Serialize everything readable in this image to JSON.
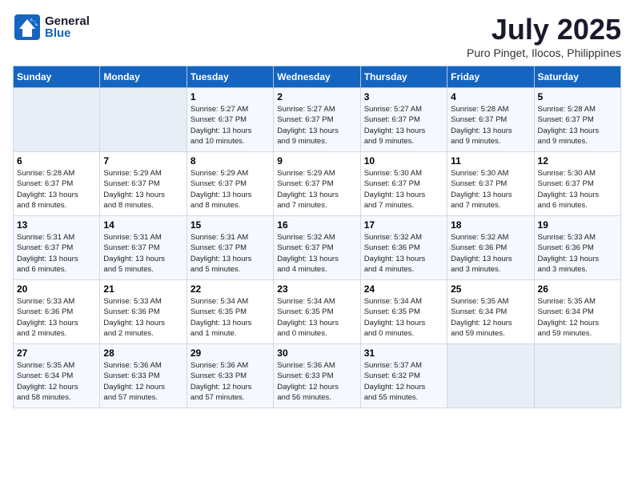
{
  "logo": {
    "general": "General",
    "blue": "Blue"
  },
  "title": "July 2025",
  "location": "Puro Pinget, Ilocos, Philippines",
  "headers": [
    "Sunday",
    "Monday",
    "Tuesday",
    "Wednesday",
    "Thursday",
    "Friday",
    "Saturday"
  ],
  "weeks": [
    [
      {
        "day": "",
        "info": ""
      },
      {
        "day": "",
        "info": ""
      },
      {
        "day": "1",
        "info": "Sunrise: 5:27 AM\nSunset: 6:37 PM\nDaylight: 13 hours\nand 10 minutes."
      },
      {
        "day": "2",
        "info": "Sunrise: 5:27 AM\nSunset: 6:37 PM\nDaylight: 13 hours\nand 9 minutes."
      },
      {
        "day": "3",
        "info": "Sunrise: 5:27 AM\nSunset: 6:37 PM\nDaylight: 13 hours\nand 9 minutes."
      },
      {
        "day": "4",
        "info": "Sunrise: 5:28 AM\nSunset: 6:37 PM\nDaylight: 13 hours\nand 9 minutes."
      },
      {
        "day": "5",
        "info": "Sunrise: 5:28 AM\nSunset: 6:37 PM\nDaylight: 13 hours\nand 9 minutes."
      }
    ],
    [
      {
        "day": "6",
        "info": "Sunrise: 5:28 AM\nSunset: 6:37 PM\nDaylight: 13 hours\nand 8 minutes."
      },
      {
        "day": "7",
        "info": "Sunrise: 5:29 AM\nSunset: 6:37 PM\nDaylight: 13 hours\nand 8 minutes."
      },
      {
        "day": "8",
        "info": "Sunrise: 5:29 AM\nSunset: 6:37 PM\nDaylight: 13 hours\nand 8 minutes."
      },
      {
        "day": "9",
        "info": "Sunrise: 5:29 AM\nSunset: 6:37 PM\nDaylight: 13 hours\nand 7 minutes."
      },
      {
        "day": "10",
        "info": "Sunrise: 5:30 AM\nSunset: 6:37 PM\nDaylight: 13 hours\nand 7 minutes."
      },
      {
        "day": "11",
        "info": "Sunrise: 5:30 AM\nSunset: 6:37 PM\nDaylight: 13 hours\nand 7 minutes."
      },
      {
        "day": "12",
        "info": "Sunrise: 5:30 AM\nSunset: 6:37 PM\nDaylight: 13 hours\nand 6 minutes."
      }
    ],
    [
      {
        "day": "13",
        "info": "Sunrise: 5:31 AM\nSunset: 6:37 PM\nDaylight: 13 hours\nand 6 minutes."
      },
      {
        "day": "14",
        "info": "Sunrise: 5:31 AM\nSunset: 6:37 PM\nDaylight: 13 hours\nand 5 minutes."
      },
      {
        "day": "15",
        "info": "Sunrise: 5:31 AM\nSunset: 6:37 PM\nDaylight: 13 hours\nand 5 minutes."
      },
      {
        "day": "16",
        "info": "Sunrise: 5:32 AM\nSunset: 6:37 PM\nDaylight: 13 hours\nand 4 minutes."
      },
      {
        "day": "17",
        "info": "Sunrise: 5:32 AM\nSunset: 6:36 PM\nDaylight: 13 hours\nand 4 minutes."
      },
      {
        "day": "18",
        "info": "Sunrise: 5:32 AM\nSunset: 6:36 PM\nDaylight: 13 hours\nand 3 minutes."
      },
      {
        "day": "19",
        "info": "Sunrise: 5:33 AM\nSunset: 6:36 PM\nDaylight: 13 hours\nand 3 minutes."
      }
    ],
    [
      {
        "day": "20",
        "info": "Sunrise: 5:33 AM\nSunset: 6:36 PM\nDaylight: 13 hours\nand 2 minutes."
      },
      {
        "day": "21",
        "info": "Sunrise: 5:33 AM\nSunset: 6:36 PM\nDaylight: 13 hours\nand 2 minutes."
      },
      {
        "day": "22",
        "info": "Sunrise: 5:34 AM\nSunset: 6:35 PM\nDaylight: 13 hours\nand 1 minute."
      },
      {
        "day": "23",
        "info": "Sunrise: 5:34 AM\nSunset: 6:35 PM\nDaylight: 13 hours\nand 0 minutes."
      },
      {
        "day": "24",
        "info": "Sunrise: 5:34 AM\nSunset: 6:35 PM\nDaylight: 13 hours\nand 0 minutes."
      },
      {
        "day": "25",
        "info": "Sunrise: 5:35 AM\nSunset: 6:34 PM\nDaylight: 12 hours\nand 59 minutes."
      },
      {
        "day": "26",
        "info": "Sunrise: 5:35 AM\nSunset: 6:34 PM\nDaylight: 12 hours\nand 59 minutes."
      }
    ],
    [
      {
        "day": "27",
        "info": "Sunrise: 5:35 AM\nSunset: 6:34 PM\nDaylight: 12 hours\nand 58 minutes."
      },
      {
        "day": "28",
        "info": "Sunrise: 5:36 AM\nSunset: 6:33 PM\nDaylight: 12 hours\nand 57 minutes."
      },
      {
        "day": "29",
        "info": "Sunrise: 5:36 AM\nSunset: 6:33 PM\nDaylight: 12 hours\nand 57 minutes."
      },
      {
        "day": "30",
        "info": "Sunrise: 5:36 AM\nSunset: 6:33 PM\nDaylight: 12 hours\nand 56 minutes."
      },
      {
        "day": "31",
        "info": "Sunrise: 5:37 AM\nSunset: 6:32 PM\nDaylight: 12 hours\nand 55 minutes."
      },
      {
        "day": "",
        "info": ""
      },
      {
        "day": "",
        "info": ""
      }
    ]
  ]
}
